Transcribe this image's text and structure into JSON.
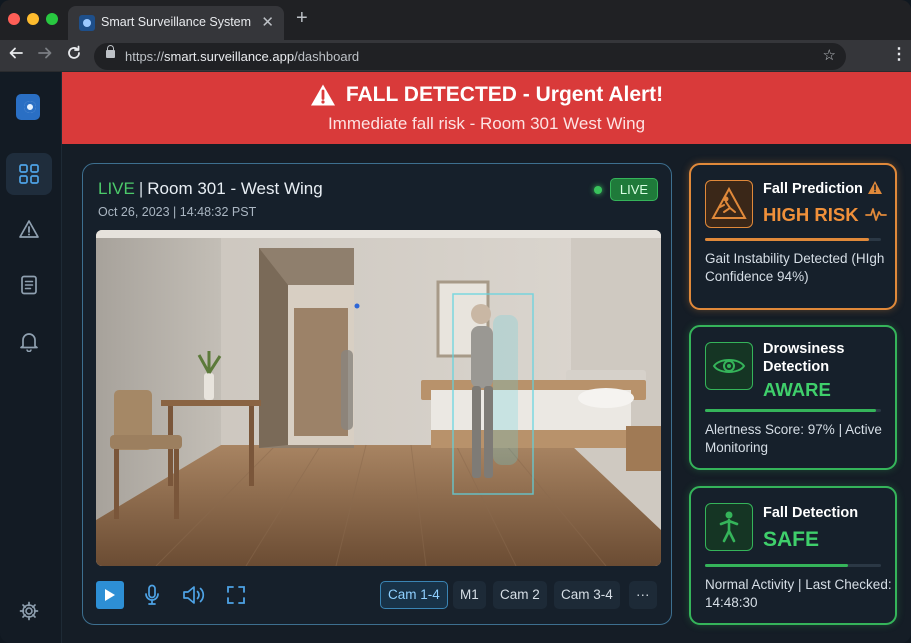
{
  "browser": {
    "tab_title": "Smart Surveillance System",
    "tab_close": "✕",
    "new_tab": "+",
    "url_scheme": "https://",
    "url_host": "smart.surveillance.app",
    "url_path": "/dashboard",
    "traffic_colors": [
      "#ff5f57",
      "#febc2e",
      "#28c840"
    ]
  },
  "sidebar": {
    "items": [
      {
        "icon": "grid-icon",
        "active": true
      },
      {
        "icon": "warning-icon",
        "active": false
      },
      {
        "icon": "document-icon",
        "active": false
      },
      {
        "icon": "bell-icon",
        "active": false
      }
    ],
    "settings_icon": "gear-icon"
  },
  "alert": {
    "title": "FALL DETECTED - Urgent Alert!",
    "subtitle": "Immediate fall risk - Room 301 West Wing",
    "color": "#d93a3a"
  },
  "camera": {
    "status": "LIVE",
    "room": "Room 301 - West Wing",
    "timestamp": "Oct 26, 2023 | 14:48:32 PST",
    "badge": "LIVE",
    "tabs": [
      {
        "label": "Cam 1-4",
        "active": true
      },
      {
        "label": "M1",
        "active": false
      },
      {
        "label": "Cam 2",
        "active": false
      },
      {
        "label": "Cam 3-4",
        "active": false
      },
      {
        "label": "···",
        "active": false
      }
    ]
  },
  "cards": {
    "fall_prediction": {
      "label": "Fall Prediction",
      "value": "HIGH RISK",
      "level": 0.93,
      "desc": "Gait Instability Detected (HIgh Confidence 94%)",
      "color": "#e0893a"
    },
    "drowsiness": {
      "label": "Drowsiness Detection",
      "value": "AWARE",
      "level": 0.97,
      "desc": "Alertness Score: 97% | Active Monitoring",
      "color": "#35b45a"
    },
    "fall_detection": {
      "label": "Fall Detection",
      "value": "SAFE",
      "level": 0.81,
      "desc": "Normal Activity | Last Checked: 14:48:30",
      "color": "#35b45a"
    }
  }
}
